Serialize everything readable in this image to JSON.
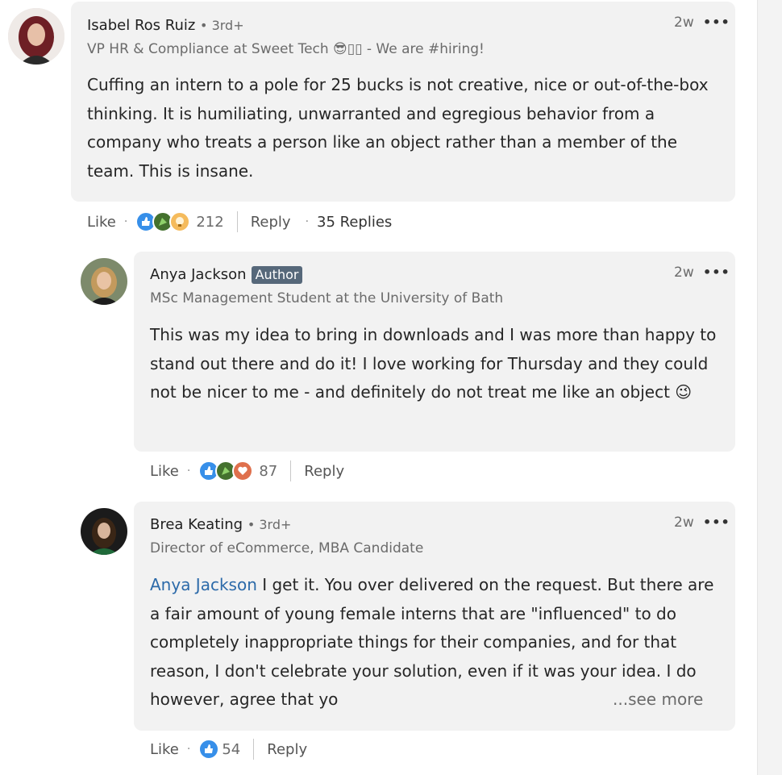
{
  "comments": [
    {
      "name": "Isabel Ros Ruiz",
      "degree": "• 3rd+",
      "headline": "VP HR & Compliance at Sweet Tech 😎▯▯ - We are #hiring!",
      "time": "2w",
      "text": "Cuffing an intern to a pole for 25 bucks is not creative, nice or out-of-the-box thinking. It is humiliating, unwarranted and egregious behavior from a company who treats a person like an object rather than a member of the team. This is insane.",
      "like_label": "Like",
      "reaction_count": "212",
      "reply_label": "Reply",
      "replies_label": "35 Replies",
      "reactions": [
        "like-icon",
        "celebrate-icon",
        "insightful-icon"
      ]
    },
    {
      "name": "Anya Jackson",
      "badge": "Author",
      "headline": "MSc Management Student at the University of Bath",
      "time": "2w",
      "text": "This was my idea to bring in downloads and I was more than happy to stand out there and do it! I love working for Thursday and they could not be nicer to me - and definitely do not treat me like an object 😉",
      "like_label": "Like",
      "reaction_count": "87",
      "reply_label": "Reply",
      "reactions": [
        "like-icon",
        "celebrate-icon",
        "love-icon"
      ]
    },
    {
      "name": "Brea Keating",
      "degree": "• 3rd+",
      "headline": "Director of eCommerce, MBA Candidate",
      "time": "2w",
      "mention": "Anya Jackson",
      "text": "I get it. You over delivered on the request. But there are a fair amount of young female interns that are \"influenced\" to do completely inappropriate things for their companies, and for that reason, I don't celebrate your solution, even if it was your idea. I do however, agree that yo",
      "see_more": "...see more",
      "like_label": "Like",
      "reaction_count": "54",
      "reply_label": "Reply",
      "reactions": [
        "like-icon"
      ]
    }
  ],
  "colors": {
    "bubble": "#f2f2f2",
    "mention": "#2c6aa9",
    "author_badge": "#56687a"
  }
}
